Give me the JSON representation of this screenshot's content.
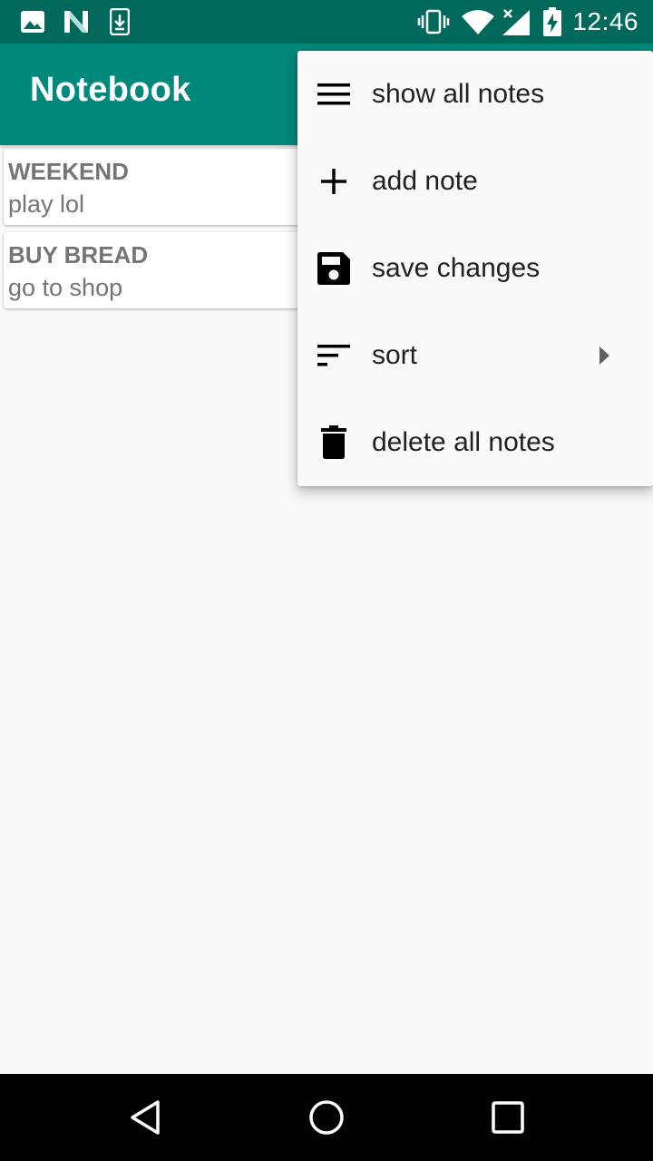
{
  "status_bar": {
    "time": "12:46",
    "left_icons": [
      "image-icon",
      "n-logo-icon",
      "download-icon"
    ],
    "right_icons": [
      "vibrate-icon",
      "wifi-icon",
      "signal-icon",
      "battery-charging-icon"
    ]
  },
  "app_bar": {
    "title": "Notebook",
    "color": "#00897b"
  },
  "notes": [
    {
      "title": "WEEKEND",
      "body": "play lol"
    },
    {
      "title": "BUY BREAD",
      "body": "go to shop"
    }
  ],
  "menu": {
    "items": [
      {
        "label": "show all notes",
        "icon": "menu-lines-icon"
      },
      {
        "label": "add note",
        "icon": "plus-icon"
      },
      {
        "label": "save changes",
        "icon": "save-icon"
      },
      {
        "label": "sort",
        "icon": "sort-icon",
        "has_submenu": true
      },
      {
        "label": "delete all notes",
        "icon": "trash-icon"
      }
    ]
  },
  "nav_bar": {
    "buttons": [
      "back-icon",
      "home-icon",
      "recents-icon"
    ]
  },
  "colors": {
    "status_bar": "#00695c",
    "app_bar": "#00897b",
    "background": "#fafafa"
  }
}
